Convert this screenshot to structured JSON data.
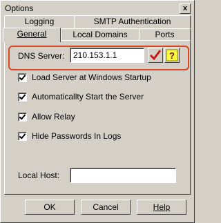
{
  "window": {
    "title": "Options",
    "close": "x"
  },
  "tabs": {
    "row1": [
      "Logging",
      "SMTP Authentication"
    ],
    "row2": [
      "General",
      "Local Domains",
      "Ports"
    ],
    "active": "General"
  },
  "dns": {
    "label": "DNS Server:",
    "value": "210.153.1.1"
  },
  "checkboxes": [
    {
      "label": "Load Server at Windows Startup",
      "checked": true
    },
    {
      "label": "Automaticallty Start the Server",
      "checked": true
    },
    {
      "label": "Allow Relay",
      "checked": true
    },
    {
      "label": "Hide Passwords In Logs",
      "checked": true
    }
  ],
  "localhost": {
    "label": "Local Host:",
    "value": ""
  },
  "buttons": {
    "ok": "OK",
    "cancel": "Cancel",
    "help": "Help"
  },
  "colors": {
    "highlight": "#d9451c",
    "check_icon": "#c81818",
    "help_icon": "#ffff40"
  }
}
